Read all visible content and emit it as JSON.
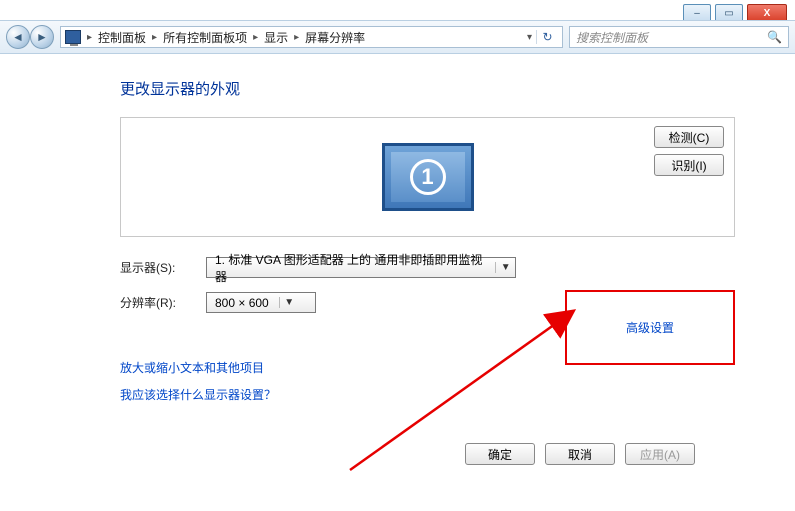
{
  "titlebar": {
    "min_icon": "–",
    "max_icon": "▭",
    "close_icon": "X"
  },
  "toolbar": {
    "back_icon": "◄",
    "fwd_icon": "►",
    "refresh_icon": "↻",
    "breadcrumb": [
      "控制面板",
      "所有控制面板项",
      "显示",
      "屏幕分辨率"
    ],
    "search_placeholder": "搜索控制面板",
    "search_icon": "🔍"
  },
  "main": {
    "heading": "更改显示器的外观",
    "detect_btn": "检测(C)",
    "identify_btn": "识别(I)",
    "monitor_number": "1",
    "display_label": "显示器(S):",
    "display_value": "1. 标准 VGA 图形适配器 上的 通用非即插即用监视器",
    "resolution_label": "分辨率(R):",
    "resolution_value": "800 × 600",
    "advanced_link": "高级设置",
    "link_text_size": "放大或缩小文本和其他项目",
    "link_which_display": "我应该选择什么显示器设置？",
    "ok_btn": "确定",
    "cancel_btn": "取消",
    "apply_btn": "应用(A)"
  }
}
